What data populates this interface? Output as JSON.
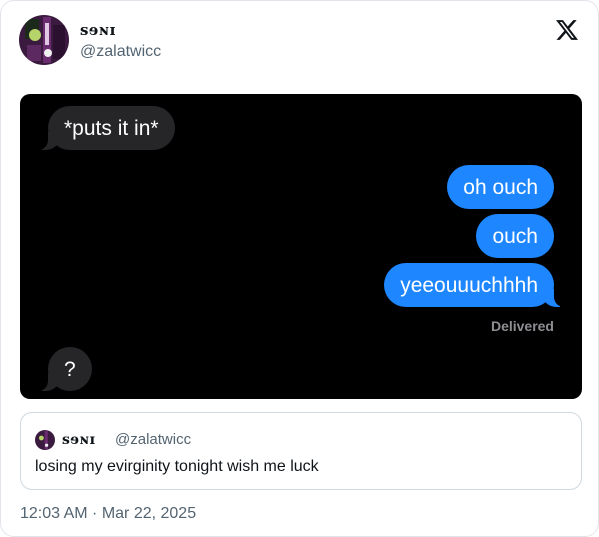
{
  "author": {
    "display_name": "ꜱɘɴɪ",
    "handle": "@zalatwicc",
    "avatar_icon": "user-avatar"
  },
  "platform": {
    "logo_icon": "x-logo-icon"
  },
  "messages": [
    {
      "side": "received",
      "text": "*puts it in*"
    },
    {
      "side": "sent",
      "text": "oh ouch"
    },
    {
      "side": "sent",
      "text": "ouch"
    },
    {
      "side": "sent",
      "text": "yeeouuuchhhh"
    },
    {
      "side": "received",
      "text": "?"
    }
  ],
  "delivered_label": "Delivered",
  "quote": {
    "display_name": "ꜱɘɴɪ",
    "handle": "@zalatwicc",
    "text": "losing my evirginity tonight wish me luck"
  },
  "timestamp": "12:03 AM · Mar 22, 2025",
  "colors": {
    "sent_bubble": "#1e87ff",
    "received_bubble": "#262629",
    "screenshot_bg": "#000000"
  }
}
